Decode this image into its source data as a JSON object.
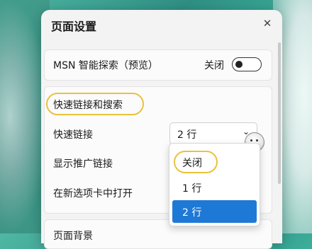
{
  "panel": {
    "title": "页面设置",
    "close_icon": "close-icon"
  },
  "msn_row": {
    "label": "MSN 智能探索（预览）",
    "toggle_state_label": "关闭",
    "toggle_on": false
  },
  "quick_links_section": {
    "heading": "快速链接和搜索",
    "rows": [
      {
        "label": "快速链接",
        "control": "select",
        "value": "2 行"
      },
      {
        "label": "显示推广链接"
      },
      {
        "label": "在新选项卡中打开"
      }
    ]
  },
  "dropdown": {
    "options": [
      "关闭",
      "1 行",
      "2 行"
    ],
    "selected": "2 行"
  },
  "next_section": {
    "heading": "页面背景"
  },
  "colors": {
    "highlight": "#e9c23e",
    "selected": "#1e79d6",
    "panel_bg": "#f3f3f3"
  }
}
